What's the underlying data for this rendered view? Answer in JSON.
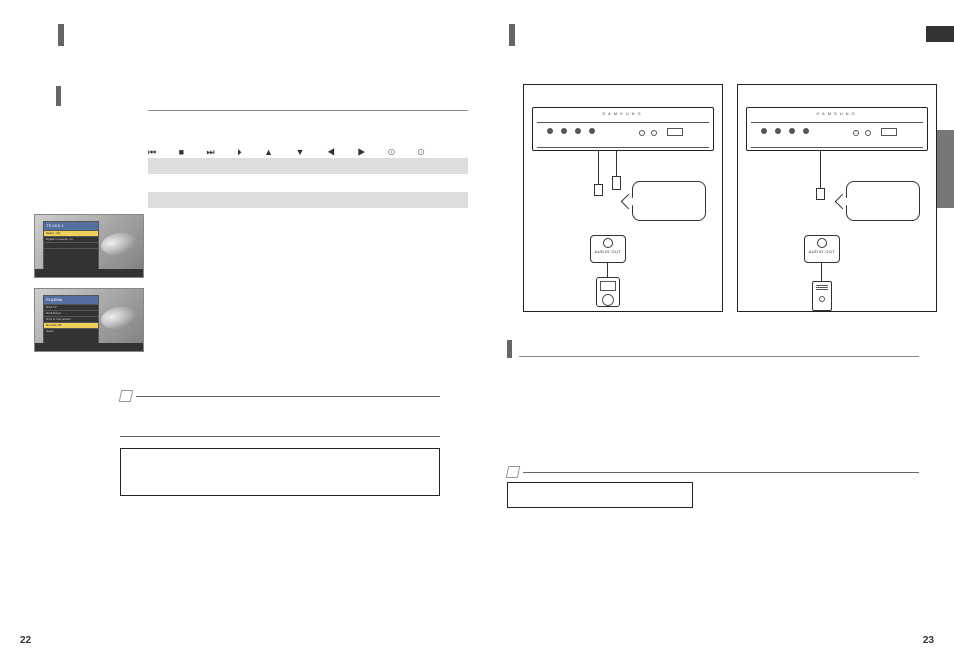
{
  "pages": {
    "left": "22",
    "right": "23"
  },
  "brand": "SAMSUNG",
  "controls_glyphs": "⏮  ■  ⏭  ⏵  ▲  ▼   ◀  ▶    ⊙  ⊙",
  "thumbs": [
    {
      "header": "TS 24 K 1",
      "rows": [
        "Setup : On",
        "Digital in receive my",
        "",
        ""
      ],
      "selected": 0
    },
    {
      "header": "PLASMA",
      "rows": [
        "iPod TV",
        "DivX/Active",
        "iPod & Connection",
        "Remote    Off",
        "Setup"
      ],
      "selected": 3
    }
  ],
  "diagrams": [
    {
      "device_label": "AUDIO OUT",
      "player_type": "ipod"
    },
    {
      "device_label": "AUDIO OUT",
      "player_type": "recorder"
    }
  ]
}
